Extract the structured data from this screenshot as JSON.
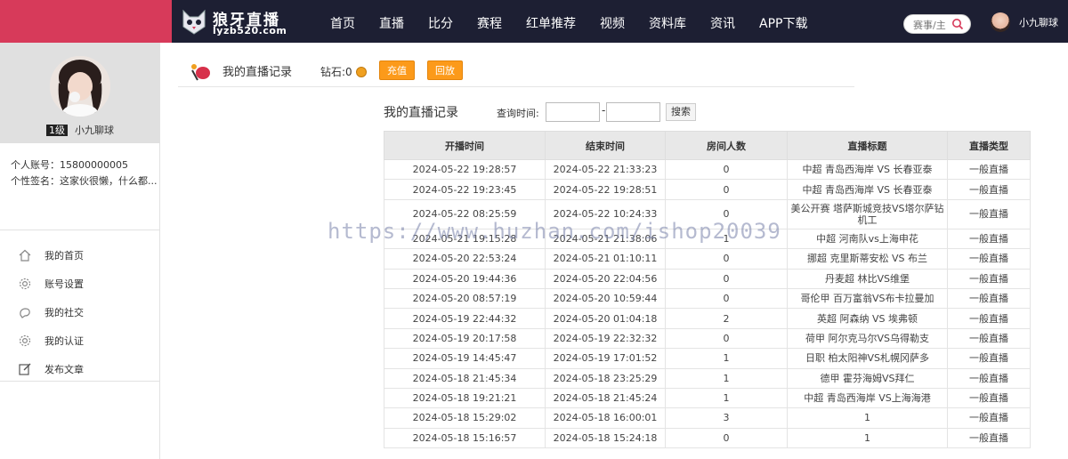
{
  "header": {
    "site_name": "狼牙直播",
    "site_url": "lyzb520.com",
    "nav": [
      "首页",
      "直播",
      "比分",
      "赛程",
      "红单推荐",
      "视频",
      "资料库",
      "资讯",
      "APP下载"
    ],
    "search_placeholder": "赛事/主",
    "user_name": "小九聊球",
    "colors": {
      "accent": "#d73a5a",
      "nav_bg": "#1d1f33"
    }
  },
  "sidebar": {
    "level": "1级",
    "nickname": "小九聊球",
    "account": "个人账号：15800000005",
    "signature": "个性签名：这家伙很懒，什么都...",
    "menu": [
      {
        "label": "我的首页",
        "icon": "home-icon"
      },
      {
        "label": "账号设置",
        "icon": "gear-icon"
      },
      {
        "label": "我的社交",
        "icon": "social-icon"
      },
      {
        "label": "我的认证",
        "icon": "certify-icon"
      },
      {
        "label": "发布文章",
        "icon": "edit-icon"
      }
    ]
  },
  "main": {
    "title": "我的直播记录",
    "diamond_label": "钻石:0",
    "recharge": "充值",
    "replay": "回放",
    "sub_title": "我的直播记录",
    "query_label": "查询时间:",
    "dash": "-",
    "search_btn": "搜索",
    "columns": [
      "开播时间",
      "结束时间",
      "房间人数",
      "直播标题",
      "直播类型"
    ],
    "rows": [
      [
        "2024-05-22 19:28:57",
        "2024-05-22 21:33:23",
        "0",
        "中超 青岛西海岸 VS 长春亚泰",
        "一般直播"
      ],
      [
        "2024-05-22 19:23:45",
        "2024-05-22 19:28:51",
        "0",
        "中超 青岛西海岸 VS 长春亚泰",
        "一般直播"
      ],
      [
        "2024-05-22 08:25:59",
        "2024-05-22 10:24:33",
        "0",
        "美公开赛 塔萨斯城竞技VS塔尔萨钻机工",
        "一般直播"
      ],
      [
        "2024-05-21 19:15:28",
        "2024-05-21 21:38:06",
        "1",
        "中超 河南队vs上海申花",
        "一般直播"
      ],
      [
        "2024-05-20 22:53:24",
        "2024-05-21 01:10:11",
        "0",
        "挪超 克里斯蒂安松 VS 布兰",
        "一般直播"
      ],
      [
        "2024-05-20 19:44:36",
        "2024-05-20 22:04:56",
        "0",
        "丹麦超 林比VS维堡",
        "一般直播"
      ],
      [
        "2024-05-20 08:57:19",
        "2024-05-20 10:59:44",
        "0",
        "哥伦甲 百万富翁VS布卡拉曼加",
        "一般直播"
      ],
      [
        "2024-05-19 22:44:32",
        "2024-05-20 01:04:18",
        "2",
        "英超 阿森纳 VS 埃弗顿",
        "一般直播"
      ],
      [
        "2024-05-19 20:17:58",
        "2024-05-19 22:32:32",
        "0",
        "荷甲 阿尔克马尔VS乌得勒支",
        "一般直播"
      ],
      [
        "2024-05-19 14:45:47",
        "2024-05-19 17:01:52",
        "1",
        "日职 柏太阳神VS札幌冈萨多",
        "一般直播"
      ],
      [
        "2024-05-18 21:45:34",
        "2024-05-18 23:25:29",
        "1",
        "德甲 霍芬海姆VS拜仁",
        "一般直播"
      ],
      [
        "2024-05-18 19:21:21",
        "2024-05-18 21:45:24",
        "1",
        "中超 青岛西海岸 VS上海海港",
        "一般直播"
      ],
      [
        "2024-05-18 15:29:02",
        "2024-05-18 16:00:01",
        "3",
        "1",
        "一般直播"
      ],
      [
        "2024-05-18 15:16:57",
        "2024-05-18 15:24:18",
        "0",
        "1",
        "一般直播"
      ]
    ],
    "watermark": "https://www.huzhan.com/ishop20039"
  }
}
